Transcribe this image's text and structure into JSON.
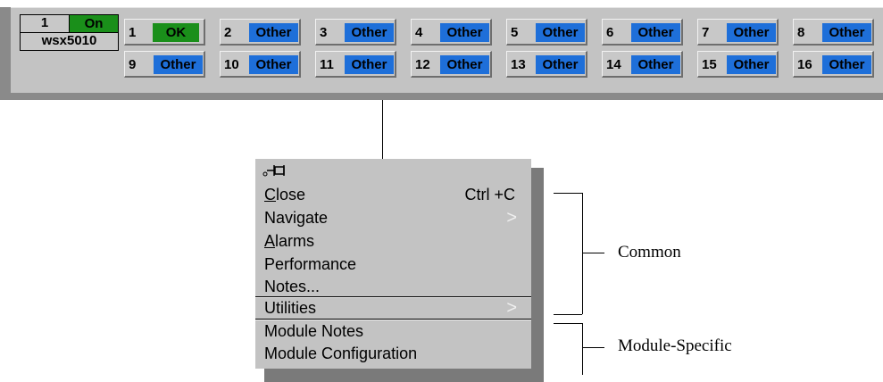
{
  "module": {
    "number": "1",
    "status": "On",
    "name": "wsx5010"
  },
  "ports": [
    {
      "num": "1",
      "status": "OK"
    },
    {
      "num": "2",
      "status": "Other"
    },
    {
      "num": "3",
      "status": "Other"
    },
    {
      "num": "4",
      "status": "Other"
    },
    {
      "num": "5",
      "status": "Other"
    },
    {
      "num": "6",
      "status": "Other"
    },
    {
      "num": "7",
      "status": "Other"
    },
    {
      "num": "8",
      "status": "Other"
    },
    {
      "num": "9",
      "status": "Other"
    },
    {
      "num": "10",
      "status": "Other"
    },
    {
      "num": "11",
      "status": "Other"
    },
    {
      "num": "12",
      "status": "Other"
    },
    {
      "num": "13",
      "status": "Other"
    },
    {
      "num": "14",
      "status": "Other"
    },
    {
      "num": "15",
      "status": "Other"
    },
    {
      "num": "16",
      "status": "Other"
    }
  ],
  "colors": {
    "ok": "#1a8f1a",
    "other": "#1e6fd9",
    "panel": "#c3c3c3"
  },
  "menu": {
    "pin_icon": "pushpin-icon",
    "items": [
      {
        "label_rest": "lose",
        "label_mnemonic": "C",
        "shortcut": "Ctrl +C"
      },
      {
        "label": "Navigate",
        "submenu_icon": ">"
      },
      {
        "label_rest": "larms",
        "label_mnemonic": "A"
      },
      {
        "label": "Performance"
      },
      {
        "label": "Notes..."
      },
      {
        "label": "Utilities",
        "submenu_icon": ">"
      },
      {
        "label": "Module Notes"
      },
      {
        "label": "Module Configuration"
      }
    ]
  },
  "annotations": {
    "common": "Common",
    "module_specific": "Module-Specific"
  }
}
